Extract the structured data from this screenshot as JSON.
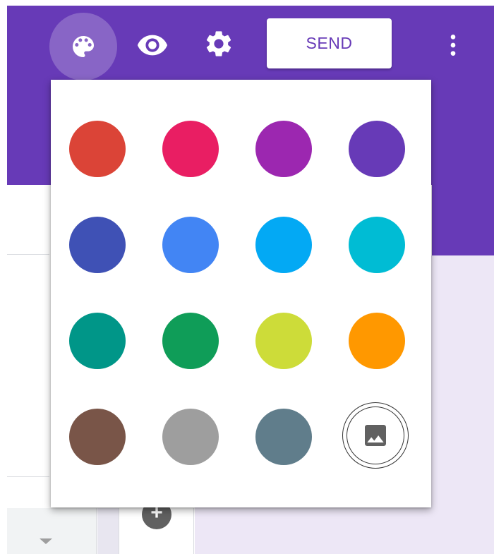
{
  "toolbar": {
    "send_label": "SEND",
    "icons": [
      "palette-icon",
      "eye-icon",
      "gear-icon",
      "more-vert-icon"
    ]
  },
  "theme_colors": {
    "header": "#673ab7",
    "background": "#ede7f6"
  },
  "color_picker": {
    "swatches": [
      {
        "name": "red",
        "color": "#db4437"
      },
      {
        "name": "pink",
        "color": "#e91e63"
      },
      {
        "name": "purple",
        "color": "#9c27b0"
      },
      {
        "name": "deep-purple",
        "color": "#673ab7"
      },
      {
        "name": "indigo",
        "color": "#3f51b5"
      },
      {
        "name": "blue",
        "color": "#4285f4"
      },
      {
        "name": "light-blue",
        "color": "#03a9f4"
      },
      {
        "name": "cyan",
        "color": "#00bcd4"
      },
      {
        "name": "teal",
        "color": "#009688"
      },
      {
        "name": "green",
        "color": "#0f9d58"
      },
      {
        "name": "lime",
        "color": "#cddc39"
      },
      {
        "name": "orange",
        "color": "#ff9800"
      },
      {
        "name": "brown",
        "color": "#795548"
      },
      {
        "name": "grey",
        "color": "#9e9e9e"
      },
      {
        "name": "blue-grey",
        "color": "#607d8b"
      }
    ],
    "image_option_icon": "image-icon"
  }
}
